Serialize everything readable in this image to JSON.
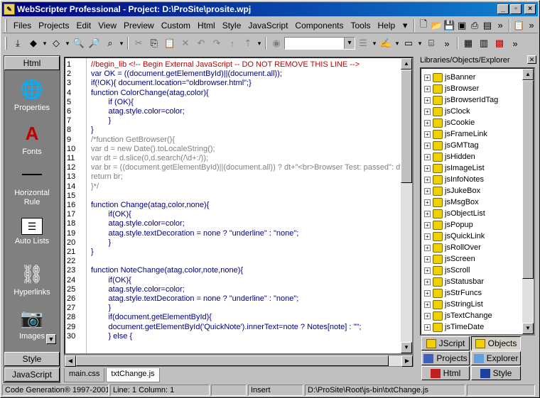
{
  "window": {
    "title": "WebScripter Professional - Project: D:\\ProSite\\prosite.wpj",
    "controls": [
      "_",
      "▫",
      "×"
    ]
  },
  "menu": [
    "Files",
    "Projects",
    "Edit",
    "View",
    "Preview",
    "Custom",
    "Html",
    "Style",
    "JavaScript",
    "Components",
    "Tools",
    "Help"
  ],
  "left_panel": {
    "header": "Html",
    "items": [
      {
        "label": "Properties",
        "icon": "globe-icon"
      },
      {
        "label": "Fonts",
        "icon": "font-icon"
      },
      {
        "label": "Horizontal Rule",
        "icon": "horizontal-rule-icon"
      },
      {
        "label": "Auto Lists",
        "icon": "list-icon"
      },
      {
        "label": "Hyperlinks",
        "icon": "chain-link-icon"
      },
      {
        "label": "Images",
        "icon": "camera-icon"
      }
    ],
    "footers": [
      "Style",
      "JavaScript"
    ]
  },
  "editor": {
    "lines": [
      {
        "n": "1",
        "text": "//begin_lib <!-- Begin External JavaScript -- DO NOT REMOVE THIS LINE -->",
        "style": "red"
      },
      {
        "n": "2",
        "text": "var OK = ((document.getElementById)||(document.all));",
        "style": "kw"
      },
      {
        "n": "3",
        "text": "if(!OK){ document.location=\"oldbrowser.html\";}",
        "style": "kw"
      },
      {
        "n": "4",
        "text": "function ColorChange(atag,color){",
        "style": "kw"
      },
      {
        "n": "5",
        "text": "        if (OK){",
        "style": "kw"
      },
      {
        "n": "6",
        "text": "        atag.style.color=color;",
        "style": "kw"
      },
      {
        "n": "7",
        "text": "        }",
        "style": "kw"
      },
      {
        "n": "8",
        "text": "}",
        "style": "kw"
      },
      {
        "n": "9",
        "text": "/*function GetBrowser(){",
        "style": "cm"
      },
      {
        "n": "10",
        "text": "var d = new Date().toLocaleString();",
        "style": "cm"
      },
      {
        "n": "11",
        "text": "var dt = d.slice(0,d.search(/\\d+:/));",
        "style": "cm"
      },
      {
        "n": "12",
        "text": "var br = ((document.getElementById)||(document.all)) ? dt+\"<br>Browser Test: passed\": dt+\"<",
        "style": "cm"
      },
      {
        "n": "13",
        "text": "return br;",
        "style": "cm"
      },
      {
        "n": "14",
        "text": "}*/",
        "style": "cm"
      },
      {
        "n": "15",
        "text": "",
        "style": "kw"
      },
      {
        "n": "16",
        "text": "function Change(atag,color,none){",
        "style": "kw"
      },
      {
        "n": "17",
        "text": "        if(OK){",
        "style": "kw"
      },
      {
        "n": "18",
        "text": "        atag.style.color=color;",
        "style": "kw"
      },
      {
        "n": "19",
        "text": "        atag.style.textDecoration = none ? \"underline\" : \"none\";",
        "style": "kw"
      },
      {
        "n": "20",
        "text": "        }",
        "style": "kw"
      },
      {
        "n": "21",
        "text": "}",
        "style": "kw"
      },
      {
        "n": "22",
        "text": "",
        "style": "kw"
      },
      {
        "n": "23",
        "text": "function NoteChange(atag,color,note,none){",
        "style": "kw"
      },
      {
        "n": "24",
        "text": "        if(OK){",
        "style": "kw"
      },
      {
        "n": "25",
        "text": "        atag.style.color=color;",
        "style": "kw"
      },
      {
        "n": "26",
        "text": "        atag.style.textDecoration = none ? \"underline\" : \"none\";",
        "style": "kw"
      },
      {
        "n": "27",
        "text": "        }",
        "style": "kw"
      },
      {
        "n": "28",
        "text": "        if(document.getElementById){",
        "style": "kw"
      },
      {
        "n": "29",
        "text": "        document.getElementById('QuickNote').innerText=note ? Notes[note] : \"\";",
        "style": "kw"
      },
      {
        "n": "30",
        "text": "        } else {",
        "style": "kw"
      }
    ]
  },
  "file_tabs": [
    {
      "label": "main.css",
      "active": false
    },
    {
      "label": "txtChange.js",
      "active": true
    }
  ],
  "right_panel": {
    "title": "Libraries/Objects/Explorer",
    "tree": [
      "jsBanner",
      "jsBrowser",
      "jsBrowserIdTag",
      "jsClock",
      "jsCookie",
      "jsFrameLink",
      "jsGMTtag",
      "jsHidden",
      "jsImageList",
      "jsInfoNotes",
      "jsJukeBox",
      "jsMsgBox",
      "jsObjectList",
      "jsPopup",
      "jsQuickLink",
      "jsRollOver",
      "jsScreen",
      "jsScroll",
      "jsStatusbar",
      "jsStrFuncs",
      "jsStringList",
      "jsTextChange",
      "jsTimeDate"
    ],
    "tabs": [
      {
        "label": "JScript",
        "active": false
      },
      {
        "label": "Objects",
        "active": true
      },
      {
        "label": "Projects",
        "active": false
      },
      {
        "label": "Explorer",
        "active": false
      },
      {
        "label": "Html",
        "active": false
      },
      {
        "label": "Style",
        "active": false
      }
    ]
  },
  "status": {
    "copyright": "Code Generation® 1997-2001",
    "position": "Line: 1  Column: 1",
    "mode": "Insert",
    "path": "D:\\ProSite\\Root\\js-bin\\txtChange.js"
  }
}
